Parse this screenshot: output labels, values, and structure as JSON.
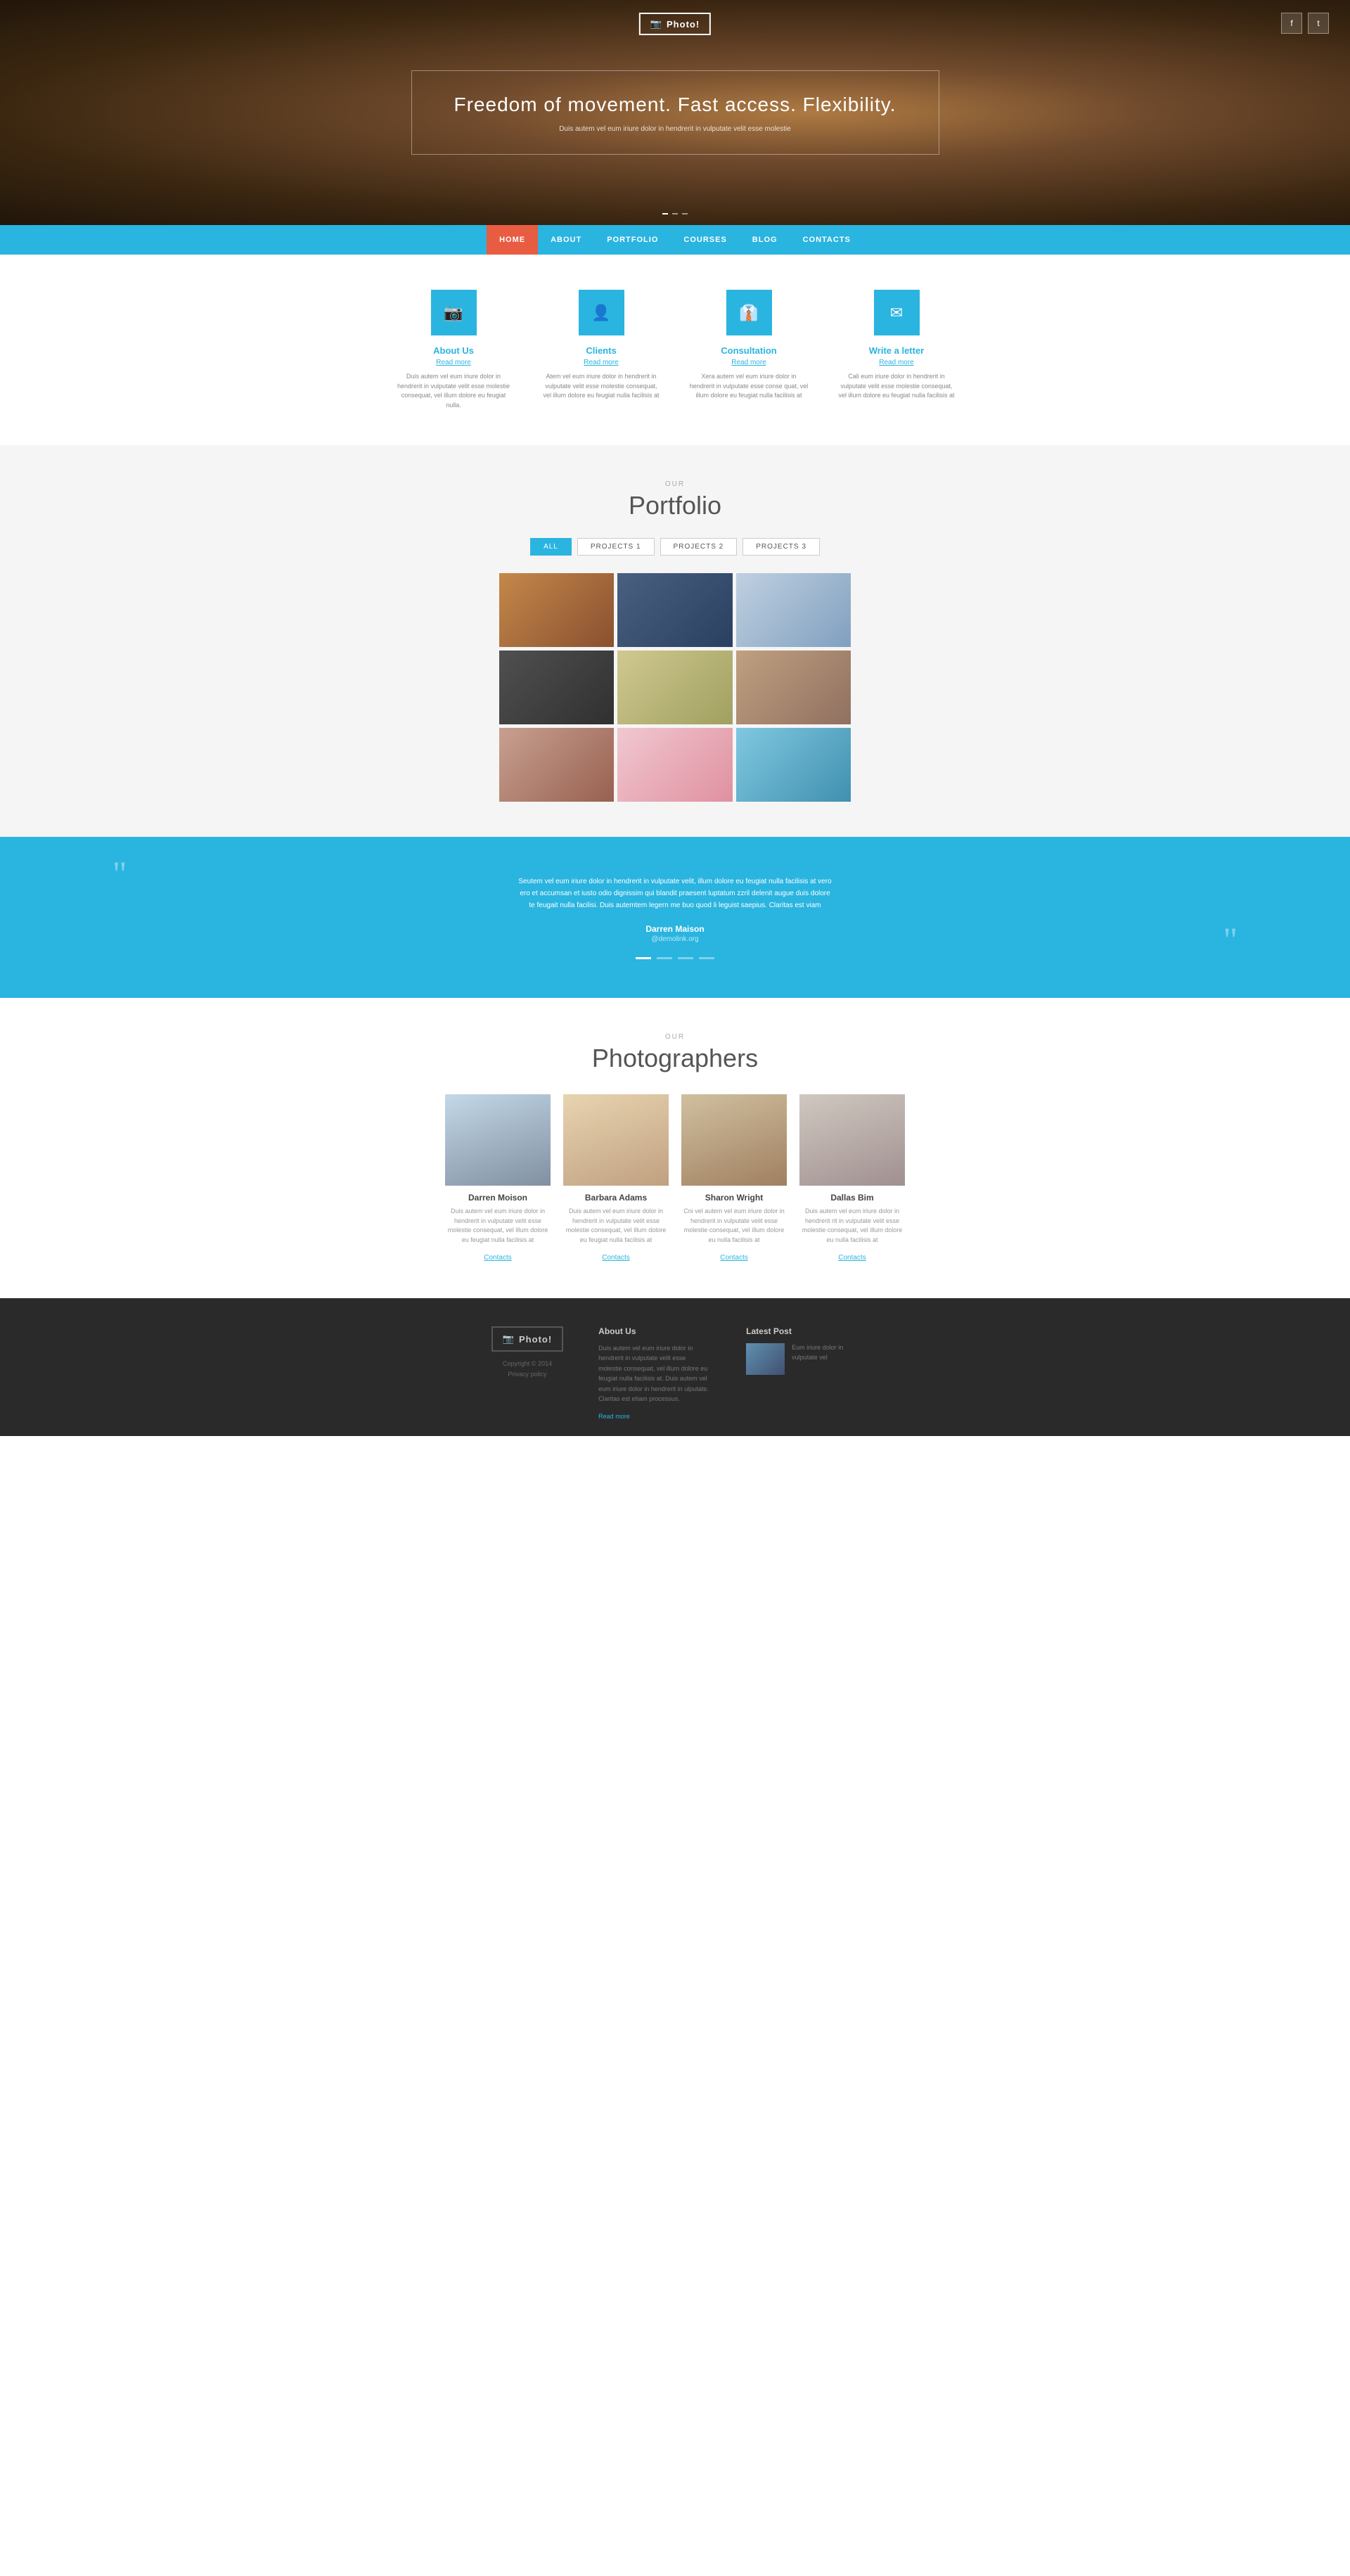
{
  "site": {
    "logo": "Photo!",
    "tagline": "Freedom of movement. Fast access. Flexibility.",
    "hero_subtitle": "Duis autem vel eum iriure dolor in hendrerit in vulputate velit esse molestie"
  },
  "hero": {
    "dots": [
      "active",
      "",
      ""
    ]
  },
  "social": {
    "facebook": "f",
    "twitter": "t"
  },
  "nav": {
    "items": [
      {
        "label": "HOME",
        "active": true
      },
      {
        "label": "ABOUT",
        "active": false
      },
      {
        "label": "PORTFOLIO",
        "active": false
      },
      {
        "label": "COURSES",
        "active": false
      },
      {
        "label": "BLOG",
        "active": false
      },
      {
        "label": "CONTACTS",
        "active": false
      }
    ]
  },
  "services": {
    "section_label": "",
    "items": [
      {
        "icon": "camera",
        "title": "About Us",
        "read_more": "Read more",
        "text": "Duis autem vel eum iriure dolor in hendrerit in vulputate velit esse molestie consequat, vel illum dolore eu feugiat nulla."
      },
      {
        "icon": "user",
        "title": "Clients",
        "read_more": "Read more",
        "text": "Atem vel eum iriure dolor in hendrerit in vulputate velit esse molestie consequat, vel illum dolore eu feugiat nulla facilisis at"
      },
      {
        "icon": "tie",
        "title": "Consultation",
        "read_more": "Read more",
        "text": "Xera autem vel eum iriure dolor in hendrerit in vulputate esse conse quat, vel illum dolore eu feugiat nulla facilisis at"
      },
      {
        "icon": "envelope",
        "title": "Write a letter",
        "read_more": "Read more",
        "text": "Cali eum iriure dolor in hendrerit in vulputate velit esse molestie consequat, vel illum dolore eu feugiat nulla facilisis at"
      }
    ]
  },
  "portfolio": {
    "label": "OUR",
    "title": "Portfolio",
    "filters": [
      "ALL",
      "PROJECTS 1",
      "PROJECTS 2",
      "PROJECTS 3"
    ],
    "active_filter": "ALL",
    "images": [
      {
        "class": "pi-1",
        "alt": "Portrait woman"
      },
      {
        "class": "pi-2",
        "alt": "Rocky coast sunset"
      },
      {
        "class": "pi-3",
        "alt": "Girl with flowers"
      },
      {
        "class": "pi-4",
        "alt": "Couple motorbike"
      },
      {
        "class": "pi-5",
        "alt": "Girl wind hair"
      },
      {
        "class": "pi-6",
        "alt": "Woman pose"
      },
      {
        "class": "pi-7",
        "alt": "Long hair woman"
      },
      {
        "class": "pi-8",
        "alt": "Girl umbrella"
      },
      {
        "class": "pi-9",
        "alt": "Woman hat sunglasses"
      }
    ]
  },
  "testimonial": {
    "text": "Seutem vel eum iriure dolor in hendrerit in vulputate velit, illum dolore eu feugiat nulla facilisis at vero ero et accumsan et iusto odio dignissim qui blandit praesent luptatum zzril delenit augue duis dolore te feugait nulla facilisi. Duis autemtem legern me buo quod li leguist saepius. Claritas est viam",
    "name": "Darren Maison",
    "handle": "@demolink.org",
    "dots": [
      "active",
      "",
      "",
      ""
    ]
  },
  "photographers": {
    "label": "OUR",
    "title": "Photographers",
    "items": [
      {
        "photo_class": "ph-1",
        "name": "Darren Moison",
        "text": "Duis autem vel eum iriure dolor in hendrerit in vulputate velit esse molestie consequat, vel illum dolore eu feugiat nulla facilisis at",
        "contact": "Contacts"
      },
      {
        "photo_class": "ph-2",
        "name": "Barbara Adams",
        "text": "Duis autem vel eum iriure dolor in hendrerit in vulputate velit esse molestie consequat, vel illum dolore eu feugiat nulla facilisis at",
        "contact": "Contacts"
      },
      {
        "photo_class": "ph-3",
        "name": "Sharon Wright",
        "text": "Cni vel autem vel eum iriure dolor in hendrerit in vulputate velit esse molestie consequat, vel illum dolore eu nulla facilisis at",
        "contact": "Contacts"
      },
      {
        "photo_class": "ph-4",
        "name": "Dallas Bim",
        "text": "Duis autem vel eum iriure dolor in hendrerit rit in vulputate velit esse molestie consequat, vel illum dolore eu nulla facilisis at",
        "contact": "Contacts"
      }
    ]
  },
  "footer": {
    "logo": "Photo!",
    "copyright": "Copyright © 2014",
    "privacy": "Privacy policy",
    "about_title": "About Us",
    "about_text": "Duis autem vel eum iriure dolor in hendrerit in vulputate velit esse molestie consequat, vel illum dolore eu feugiat nulla facilisis at. Duis autem vel eum iriure dolor in hendrerit in ulputate. Claritas est etiam processus.",
    "about_read": "Read more",
    "latest_title": "Latest Post",
    "latest_text": "Eum iriure dolor in vulputate vel"
  }
}
